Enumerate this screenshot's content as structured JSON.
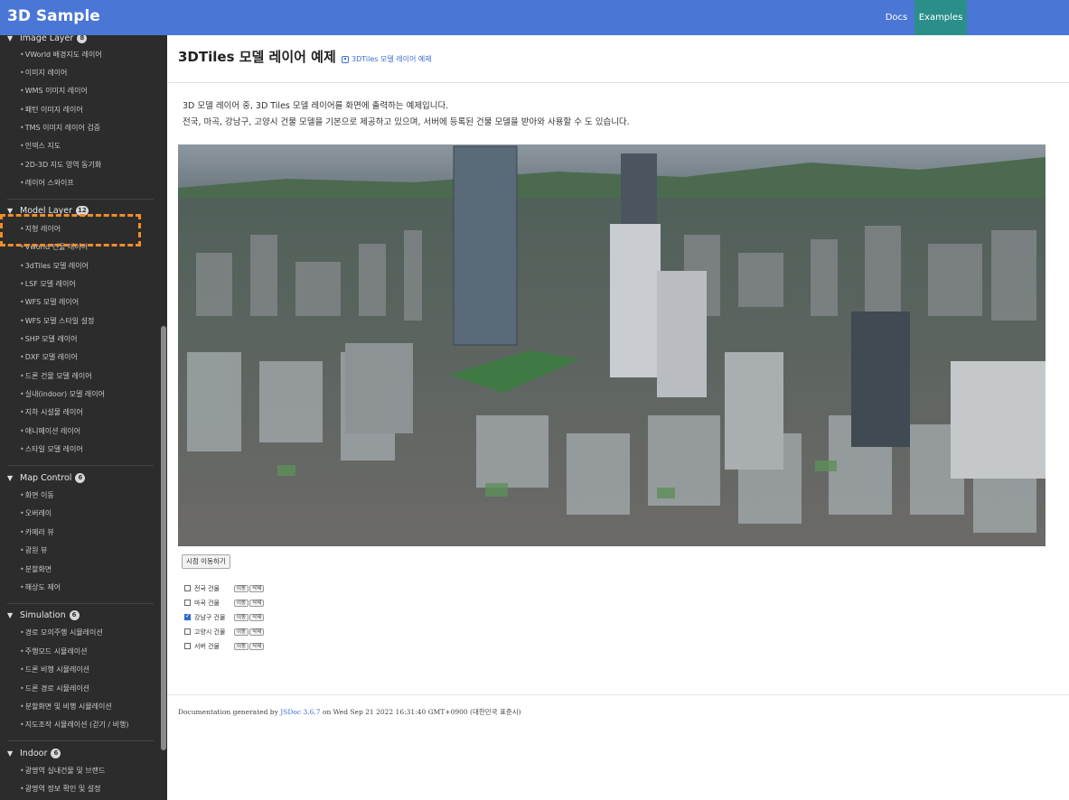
{
  "header": {
    "brand": "3D Sample",
    "nav": {
      "docs": "Docs",
      "examples": "Examples"
    }
  },
  "colors": {
    "header_bg": "#4a76d6",
    "sidebar_bg": "#2c2c2c",
    "active_nav": "#2a8f8a",
    "highlight": "#f28c28",
    "link": "#3a6fcf"
  },
  "sidebar": {
    "image_layer": {
      "title": "Image Layer",
      "count": "8",
      "items": [
        "VWorld 배경지도 레이어",
        "이미지 레이어",
        "WMS 이미지 레이어",
        "패턴 이미지 레이어",
        "TMS 이미지 레이어 검증",
        "인덱스 지도",
        "2D-3D 지도 영역 동기화",
        "레이어 스와이프"
      ]
    },
    "model_layer": {
      "title": "Model Layer",
      "count": "12",
      "items": [
        "지형 레이어",
        "Vworld 건물 레이어",
        "3dTiles 모델 레이어",
        "LSF 모델 레이어",
        "WFS 모델 레이어",
        "WFS 모델 스타일 설정",
        "SHP 모델 레이어",
        "DXF 모델 레이어",
        "드론 건물 모델 레이어",
        "실내(indoor) 모델 레이어",
        "지하 시설물 레이어",
        "애니메이션 레이어",
        "스타일 모델 레이어"
      ]
    },
    "map_control": {
      "title": "Map Control",
      "count": "6",
      "items": [
        "화면 이동",
        "오버레이",
        "카메라 뷰",
        "광원 뷰",
        "분할화면",
        "해상도 제어"
      ]
    },
    "simulation": {
      "title": "Simulation",
      "count": "6",
      "items": [
        "경로 모의주행 시뮬레이션",
        "주행모드 시뮬레이션",
        "드론 비행 시뮬레이션",
        "드론 경로 시뮬레이션",
        "분할화면 및 비행 시뮬레이션",
        "지도조작 시뮬레이션 (걷기 / 비행)"
      ]
    },
    "indoor": {
      "title": "Indoor",
      "count": "6",
      "items": [
        "광명역 실내건물 및 브랜드",
        "광명역 정보 확인 및 설정"
      ]
    }
  },
  "main": {
    "title": "3DTiles 모델 레이어 예제",
    "source_link": "3DTiles 모델 레이어 예제",
    "desc_line1": "3D 모델 레이어 중, 3D Tiles 모델 레이어를 화면에 출력하는 예제입니다.",
    "desc_line2": "전국, 마곡, 강남구, 고양시 건물 모델을 기본으로 제공하고 있으며, 서버에 등록된 건물 모델을 받아와 사용할 수 도 있습니다.",
    "init_button": "시점 이동하기",
    "layers": [
      {
        "label": "전국 건물",
        "checked": false
      },
      {
        "label": "마곡 건물",
        "checked": false
      },
      {
        "label": "강남구 건물",
        "checked": true
      },
      {
        "label": "고양시 건물",
        "checked": false
      },
      {
        "label": "서버 건물",
        "checked": false
      }
    ],
    "layer_btn_move": "이동",
    "layer_btn_delete": "삭제",
    "footer_prefix": "Documentation generated by",
    "footer_link": "JSDoc 3.6.7",
    "footer_suffix": "on Wed Sep 21 2022 16:31:40 GMT+0900 (대한민국 표준시)"
  }
}
